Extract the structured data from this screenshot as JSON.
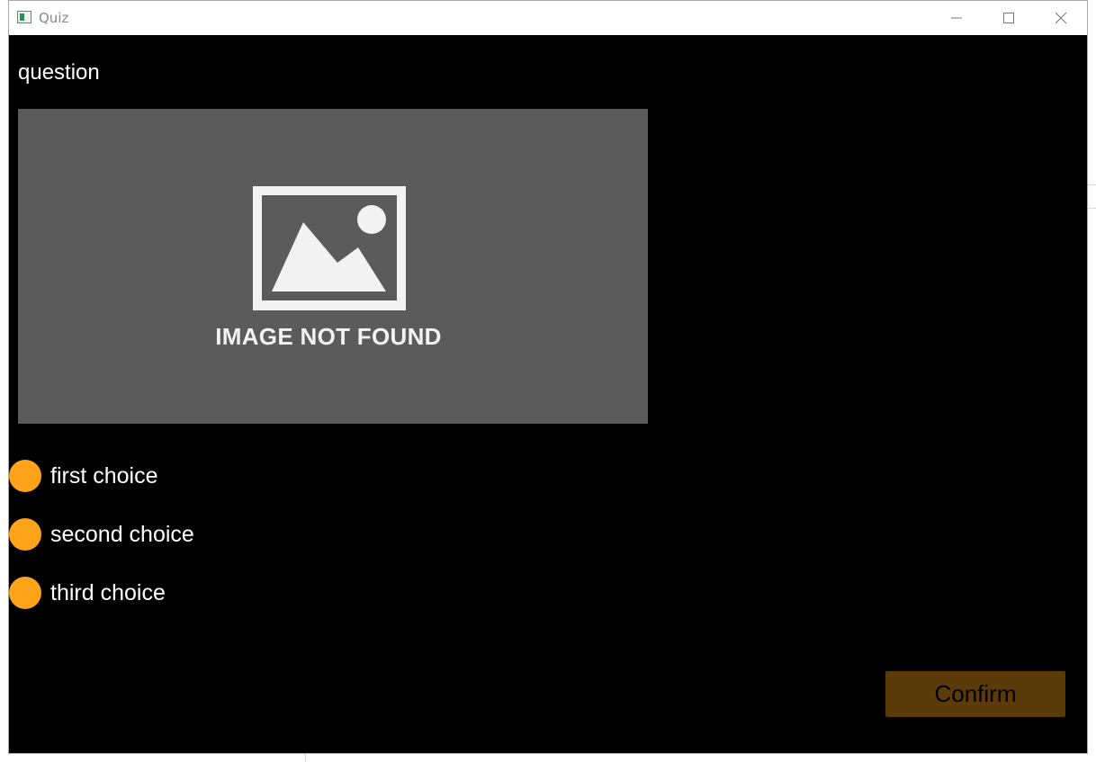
{
  "window": {
    "title": "Quiz",
    "icon": "app-window-icon",
    "controls": [
      "minimize-icon",
      "maximize-icon",
      "close-icon"
    ]
  },
  "quiz": {
    "question": "question",
    "image": {
      "icon": "image-placeholder-icon",
      "caption": "IMAGE NOT FOUND"
    },
    "choices": [
      {
        "label": "first choice"
      },
      {
        "label": "second choice"
      },
      {
        "label": "third choice"
      }
    ],
    "confirm_label": "Confirm"
  },
  "colors": {
    "background": "#000000",
    "image_placeholder": "#5b5b5b",
    "radio": "#ffa31a",
    "confirm_button": "#5c3b0b",
    "text": "#ffffff"
  }
}
